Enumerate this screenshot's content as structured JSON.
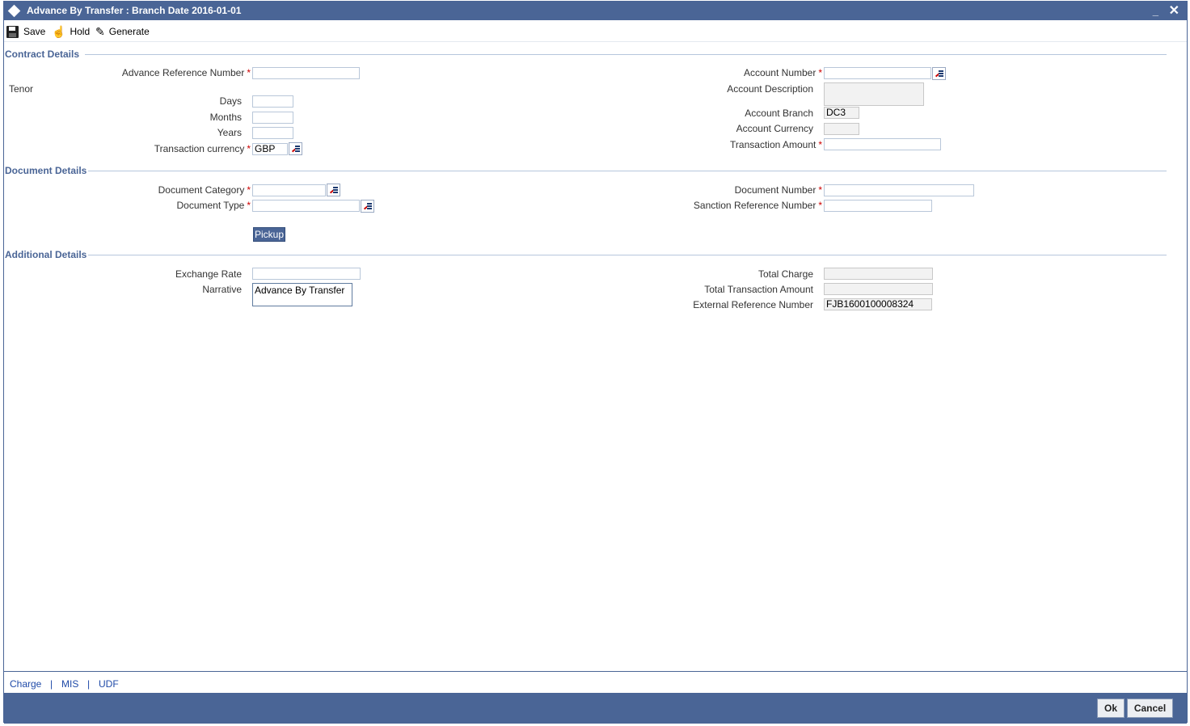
{
  "window": {
    "title": "Advance By Transfer : Branch Date 2016-01-01",
    "minimize": "_",
    "close": "✕"
  },
  "toolbar": {
    "save": "Save",
    "hold": "Hold",
    "generate": "Generate"
  },
  "sections": {
    "contract": "Contract Details",
    "document": "Document Details",
    "additional": "Additional Details"
  },
  "contract": {
    "advance_ref_label": "Advance Reference Number",
    "advance_ref_value": "",
    "tenor_label": "Tenor",
    "days_label": "Days",
    "days_value": "",
    "months_label": "Months",
    "months_value": "",
    "years_label": "Years",
    "years_value": "",
    "txn_currency_label": "Transaction currency",
    "txn_currency_value": "GBP",
    "account_number_label": "Account Number",
    "account_number_value": "",
    "account_desc_label": "Account Description",
    "account_desc_value": "",
    "account_branch_label": "Account Branch",
    "account_branch_value": "DC3",
    "account_currency_label": "Account Currency",
    "account_currency_value": "",
    "txn_amount_label": "Transaction Amount",
    "txn_amount_value": ""
  },
  "document": {
    "category_label": "Document Category",
    "category_value": "",
    "type_label": "Document Type",
    "type_value": "",
    "number_label": "Document Number",
    "number_value": "",
    "sanction_ref_label": "Sanction Reference Number",
    "sanction_ref_value": "",
    "pickup": "Pickup"
  },
  "additional": {
    "exchange_rate_label": "Exchange Rate",
    "exchange_rate_value": "",
    "narrative_label": "Narrative",
    "narrative_value": "Advance By Transfer",
    "total_charge_label": "Total Charge",
    "total_charge_value": "",
    "total_txn_amount_label": "Total Transaction Amount",
    "total_txn_amount_value": "",
    "external_ref_label": "External Reference Number",
    "external_ref_value": "FJB1600100008324"
  },
  "links": {
    "charge": "Charge",
    "mis": "MIS",
    "udf": "UDF",
    "separator": "|"
  },
  "footer": {
    "ok": "Ok",
    "cancel": "Cancel"
  },
  "required_mark": "*"
}
